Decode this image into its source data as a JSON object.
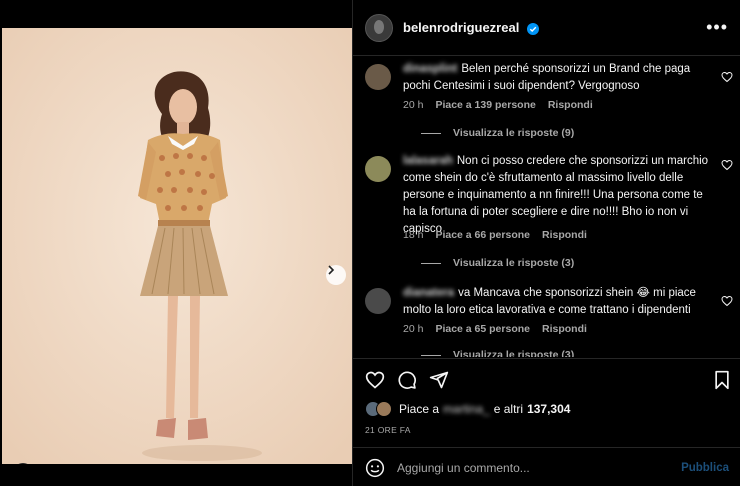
{
  "header": {
    "username": "belenrodriguezreal",
    "verified": true
  },
  "comments": [
    {
      "user": "dinasplint",
      "text": "Belen perché sponsorizzi un Brand che paga pochi Centesimi i suoi dipendent? Vergognoso",
      "time": "20 h",
      "likes": "Piace a 139 persone",
      "reply": "Rispondi",
      "replies": "Visualizza le risposte (9)"
    },
    {
      "user": "lalasarah",
      "text": "Non ci posso credere che sponsorizzi un marchio come shein do c'è sfruttamento al massimo livello delle persone e inquinamento a nn finire!!! Una persona come te ha la fortuna di poter scegliere e dire no!!!! Bho io non vi capisco",
      "time": "18 h",
      "likes": "Piace a 66 persone",
      "reply": "Rispondi",
      "replies": "Visualizza le risposte (3)"
    },
    {
      "user": "dianatera",
      "text": "va Mancava che sponsorizzi shein 😂 mi piace molto la loro etica lavorativa e come trattano i dipendenti",
      "time": "20 h",
      "likes": "Piace a 65 persone",
      "reply": "Rispondi",
      "replies": "Visualizza le risposte (3)"
    }
  ],
  "likes_line": {
    "prefix": "Piace a",
    "user": "martina_",
    "suffix": "e altri",
    "count": "137,304"
  },
  "time_ago": "21 ORE FA",
  "composer": {
    "placeholder": "Aggiungi un commento...",
    "publish": "Pubblica"
  },
  "colors": {
    "background": "#000000",
    "accent": "#0095f6",
    "muted_text": "#a8a8a8",
    "photo_bg": "#f1dcc8"
  },
  "icons": [
    "heart-icon",
    "comment-icon",
    "share-icon",
    "bookmark-icon",
    "emoji-icon",
    "more-icon",
    "verified-icon",
    "next-arrow-icon",
    "user-tag-icon"
  ]
}
